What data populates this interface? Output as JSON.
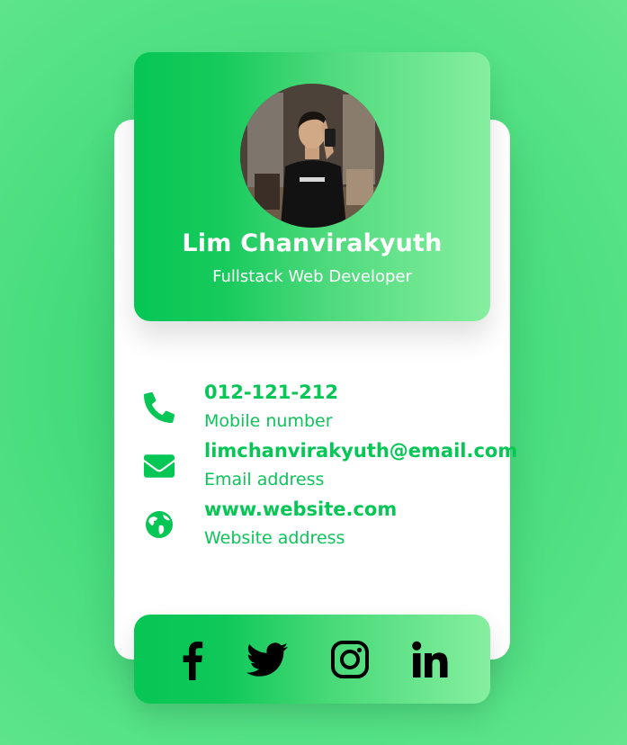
{
  "profile": {
    "name": "Lim Chanvirakyuth",
    "role": "Fullstack Web Developer"
  },
  "contacts": [
    {
      "icon": "phone-icon",
      "value": "012-121-212",
      "label": "Mobile number"
    },
    {
      "icon": "envelope-icon",
      "value": "limchanvirakyuth@email.com",
      "label": "Email address"
    },
    {
      "icon": "globe-icon",
      "value": "www.website.com",
      "label": "Website address"
    }
  ],
  "social": [
    "facebook-icon",
    "twitter-icon",
    "instagram-icon",
    "linkedin-icon"
  ],
  "colors": {
    "accent": "#06c655",
    "background": "#45dc7c",
    "card": "#ffffff"
  }
}
